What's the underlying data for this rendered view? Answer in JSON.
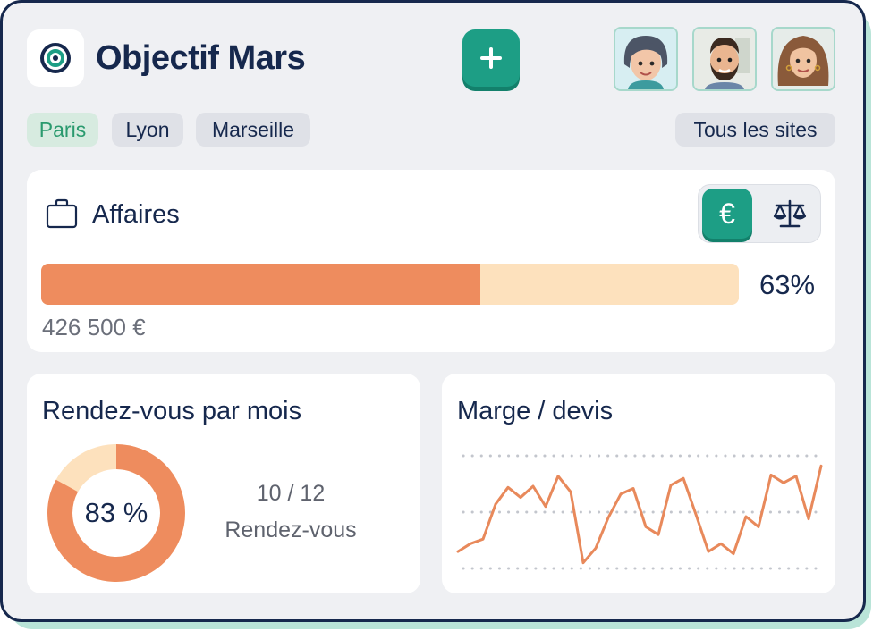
{
  "app": {
    "title": "Objectif Mars",
    "logo_icon": "target-icon",
    "add_icon": "plus-icon"
  },
  "avatars": [
    {
      "name": "avatar-woman-short-hair"
    },
    {
      "name": "avatar-man-beard"
    },
    {
      "name": "avatar-woman-curly-hair"
    }
  ],
  "sites": {
    "tabs": [
      {
        "label": "Paris",
        "active": true
      },
      {
        "label": "Lyon",
        "active": false
      },
      {
        "label": "Marseille",
        "active": false
      }
    ],
    "all_label": "Tous les sites"
  },
  "affaires": {
    "title": "Affaires",
    "icon": "briefcase-icon",
    "toggle": [
      {
        "icon": "euro-icon",
        "label": "€",
        "active": true
      },
      {
        "icon": "scale-icon",
        "active": false
      }
    ],
    "progress": 0.63,
    "percent_label": "63%",
    "amount": "426 500 €"
  },
  "rendezvous": {
    "title": "Rendez-vous par mois",
    "percent_label": "83 %",
    "ratio": "10 / 12",
    "label": "Rendez-vous",
    "donut_fraction": 0.83
  },
  "marge": {
    "title": "Marge / devis",
    "gridlines": 3
  },
  "chart_data": {
    "type": "line",
    "title": "Marge / devis",
    "xlabel": "",
    "ylabel": "",
    "ylim": [
      0,
      100
    ],
    "grid": true,
    "series": [
      {
        "values": [
          15,
          22,
          26,
          57,
          72,
          63,
          73,
          55,
          82,
          68,
          5,
          18,
          45,
          66,
          71,
          37,
          30,
          74,
          80,
          48,
          15,
          22,
          13,
          46,
          37,
          83,
          76,
          82,
          44,
          91
        ],
        "color": "#e8895b"
      }
    ]
  },
  "colors": {
    "accent": "#1d9e85",
    "navy": "#16284d",
    "orange": "#ee8c5e",
    "peach": "#fde1bd",
    "background": "#eff0f3"
  }
}
